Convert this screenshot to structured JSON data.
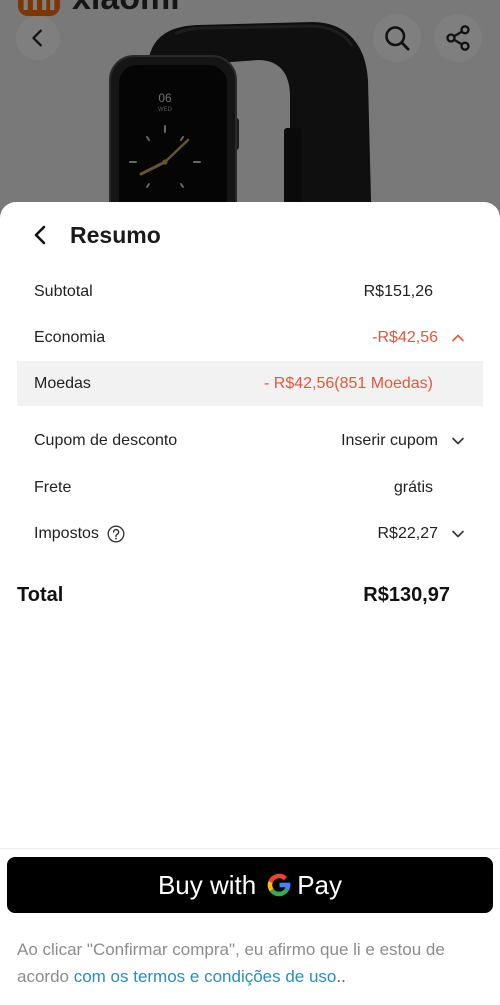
{
  "header_bar": {
    "brand_logo_text": "xiaomi",
    "logo_glyph_text": "mi",
    "back_icon": "chevron-left-icon",
    "search_icon": "search-icon",
    "share_icon": "share-icon"
  },
  "product_image": {
    "watch_hour": "06",
    "watch_weekday": "WED"
  },
  "summary": {
    "title": "Resumo",
    "back_icon": "chevron-left-icon",
    "subtotal": {
      "label": "Subtotal",
      "value": "R$151,26"
    },
    "savings": {
      "label": "Economia",
      "value": "-R$42,56",
      "expanded": true,
      "toggle_icon": "chevron-up-icon"
    },
    "coins": {
      "label": "Moedas",
      "value": "- R$42,56(851 Moedas)"
    },
    "coupon": {
      "label": "Cupom de desconto",
      "value": "Inserir cupom",
      "toggle_icon": "chevron-down-icon"
    },
    "shipping": {
      "label": "Frete",
      "value": "grátis"
    },
    "taxes": {
      "label": "Impostos",
      "value": "R$22,27",
      "help_icon": "question-circle-icon",
      "toggle_icon": "chevron-down-icon"
    },
    "total": {
      "label": "Total",
      "value": "R$130,97"
    }
  },
  "payment_button": {
    "prefix": "Buy with",
    "logo_icon": "google-g-icon",
    "brand": "Pay"
  },
  "disclaimer": {
    "text_before": "Ao clicar \"Confirmar compra\", eu afirmo que li e estou de acordo ",
    "link_text": "com os termos e condições de uso",
    "text_after": ".."
  },
  "colors": {
    "accent": "#e5573d",
    "link": "#2b8db8",
    "text": "#222222",
    "muted": "#8c8c8c",
    "highlight_row": "#f2f2f2",
    "button_bg": "#000000",
    "brand_orange": "#ff6a00"
  }
}
